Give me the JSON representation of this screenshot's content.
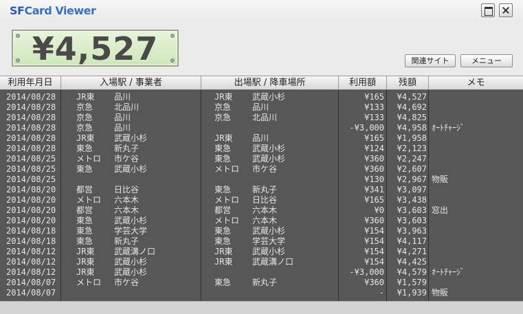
{
  "app": {
    "title_sf": "SF",
    "title_rest": "Card Viewer"
  },
  "balance": {
    "value": "¥4,527"
  },
  "buttons": {
    "site": "関連サイト",
    "menu": "メニュー"
  },
  "table": {
    "headers": [
      "利用年月日",
      "入場駅 / 事業者",
      "出場駅 / 降車場所",
      "利用額",
      "残額",
      "メモ"
    ],
    "rows": [
      {
        "date": "2014/08/28",
        "in_co": "JR東",
        "in_st": "品川",
        "out_co": "JR東",
        "out_st": "武蔵小杉",
        "amount": "¥165",
        "balance": "¥4,527",
        "memo": ""
      },
      {
        "date": "2014/08/28",
        "in_co": "京急",
        "in_st": "北品川",
        "out_co": "京急",
        "out_st": "品川",
        "amount": "¥133",
        "balance": "¥4,692",
        "memo": ""
      },
      {
        "date": "2014/08/28",
        "in_co": "京急",
        "in_st": "品川",
        "out_co": "京急",
        "out_st": "北品川",
        "amount": "¥133",
        "balance": "¥4,825",
        "memo": ""
      },
      {
        "date": "2014/08/28",
        "in_co": "京急",
        "in_st": "品川",
        "out_co": "",
        "out_st": "",
        "amount": "-¥3,000",
        "balance": "¥4,958",
        "memo": "ｵｰﾄﾁｬｰｼﾞ"
      },
      {
        "date": "2014/08/28",
        "in_co": "JR東",
        "in_st": "武蔵小杉",
        "out_co": "JR東",
        "out_st": "品川",
        "amount": "¥165",
        "balance": "¥1,958",
        "memo": ""
      },
      {
        "date": "2014/08/28",
        "in_co": "東急",
        "in_st": "新丸子",
        "out_co": "東急",
        "out_st": "武蔵小杉",
        "amount": "¥124",
        "balance": "¥2,123",
        "memo": ""
      },
      {
        "date": "2014/08/25",
        "in_co": "メトロ",
        "in_st": "市ケ谷",
        "out_co": "東急",
        "out_st": "武蔵小杉",
        "amount": "¥360",
        "balance": "¥2,247",
        "memo": ""
      },
      {
        "date": "2014/08/25",
        "in_co": "東急",
        "in_st": "武蔵小杉",
        "out_co": "メトロ",
        "out_st": "市ケ谷",
        "amount": "¥360",
        "balance": "¥2,607",
        "memo": ""
      },
      {
        "date": "2014/08/25",
        "in_co": "",
        "in_st": "",
        "out_co": "",
        "out_st": "",
        "amount": "¥130",
        "balance": "¥2,967",
        "memo": "物販"
      },
      {
        "date": "2014/08/20",
        "in_co": "都営",
        "in_st": "日比谷",
        "out_co": "東急",
        "out_st": "新丸子",
        "amount": "¥341",
        "balance": "¥3,097",
        "memo": ""
      },
      {
        "date": "2014/08/20",
        "in_co": "メトロ",
        "in_st": "六本木",
        "out_co": "メトロ",
        "out_st": "日比谷",
        "amount": "¥165",
        "balance": "¥3,438",
        "memo": ""
      },
      {
        "date": "2014/08/20",
        "in_co": "都営",
        "in_st": "六本木",
        "out_co": "都営",
        "out_st": "六本木",
        "amount": "¥0",
        "balance": "¥3,603",
        "memo": "窓出"
      },
      {
        "date": "2014/08/20",
        "in_co": "東急",
        "in_st": "武蔵小杉",
        "out_co": "メトロ",
        "out_st": "六本木",
        "amount": "¥360",
        "balance": "¥3,603",
        "memo": ""
      },
      {
        "date": "2014/08/18",
        "in_co": "東急",
        "in_st": "学芸大学",
        "out_co": "東急",
        "out_st": "武蔵小杉",
        "amount": "¥154",
        "balance": "¥3,963",
        "memo": ""
      },
      {
        "date": "2014/08/18",
        "in_co": "東急",
        "in_st": "新丸子",
        "out_co": "東急",
        "out_st": "学芸大学",
        "amount": "¥154",
        "balance": "¥4,117",
        "memo": ""
      },
      {
        "date": "2014/08/12",
        "in_co": "JR東",
        "in_st": "武蔵溝ノ口",
        "out_co": "JR東",
        "out_st": "武蔵小杉",
        "amount": "¥154",
        "balance": "¥4,271",
        "memo": ""
      },
      {
        "date": "2014/08/12",
        "in_co": "JR東",
        "in_st": "武蔵小杉",
        "out_co": "JR東",
        "out_st": "武蔵溝ノ口",
        "amount": "¥154",
        "balance": "¥4,425",
        "memo": ""
      },
      {
        "date": "2014/08/12",
        "in_co": "JR東",
        "in_st": "武蔵小杉",
        "out_co": "",
        "out_st": "",
        "amount": "-¥3,000",
        "balance": "¥4,579",
        "memo": "ｵｰﾄﾁｬｰｼﾞ"
      },
      {
        "date": "2014/08/07",
        "in_co": "メトロ",
        "in_st": "市ケ谷",
        "out_co": "東急",
        "out_st": "新丸子",
        "amount": "¥360",
        "balance": "¥1,579",
        "memo": ""
      },
      {
        "date": "2014/08/07",
        "in_co": "",
        "in_st": "",
        "out_co": "",
        "out_st": "",
        "amount": "-",
        "balance": "¥1,939",
        "memo": "物販"
      }
    ]
  }
}
